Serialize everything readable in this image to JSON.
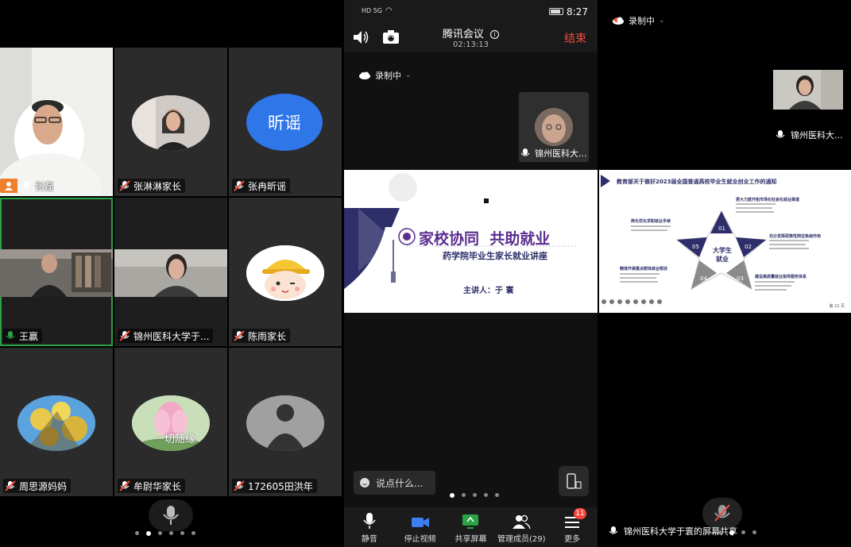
{
  "left": {
    "participants": [
      {
        "name": "张磊",
        "kind": "photo-man",
        "host": true
      },
      {
        "name": "张淋淋家长",
        "kind": "photo-woman"
      },
      {
        "name": "张冉昕谣",
        "kind": "text-avatar",
        "avatar_text": "昕谣"
      },
      {
        "name": "王赢",
        "kind": "video-room",
        "active": true
      },
      {
        "name": "锦州医科大学于...",
        "kind": "video-woman"
      },
      {
        "name": "陈雨家长",
        "kind": "cartoon"
      },
      {
        "name": "周思源妈妈",
        "kind": "flowers-yellow"
      },
      {
        "name": "牟尉华家长",
        "kind": "lotus",
        "overlay_text": "一切随缘"
      },
      {
        "name": "172605田洪年",
        "kind": "silhouette"
      }
    ]
  },
  "mid": {
    "status": {
      "time": "8:27",
      "network": "HD 5G"
    },
    "app_title": "腾讯会议",
    "duration": "02:13:13",
    "end_label": "结束",
    "recording_label": "录制中",
    "self_tile_name": "锦州医科大...",
    "slide": {
      "title": "家校协同  共助就业",
      "subtitle": "药学院毕业生家长就业讲座",
      "speaker": "主讲人：于 寰"
    },
    "chat_placeholder": "说点什么...",
    "toolbar": [
      {
        "label": "静音",
        "icon": "mic-icon"
      },
      {
        "label": "停止视频",
        "icon": "video-icon"
      },
      {
        "label": "共享屏幕",
        "icon": "share-screen-icon"
      },
      {
        "label": "管理成员(29)",
        "icon": "members-icon"
      },
      {
        "label": "更多",
        "icon": "more-icon",
        "badge": "11"
      }
    ]
  },
  "right": {
    "recording_label": "录制中",
    "self_tile_name": "锦州医科大...",
    "slide": {
      "header": "教育部关于做好2023届全国普通高校毕业生就业创业工作的通知",
      "center": "大学生就业",
      "items": [
        {
          "num": "01",
          "title": "更大力度开拓市场化社会化就业渠道"
        },
        {
          "num": "02",
          "title": "充分发挥政策性岗位吸纳作用"
        },
        {
          "num": "03",
          "title": "建设高质量就业指导服务体系"
        },
        {
          "num": "04",
          "title": "精准开展重点群体就业帮扶"
        },
        {
          "num": "05",
          "title": "简化优化求职就业手续"
        }
      ],
      "page": "第 22 页"
    },
    "footer_name": "锦州医科大学于寰的屏幕共享"
  },
  "colors": {
    "accent_green": "#2ba245",
    "end_red": "#f04c3e",
    "slide_navy": "#2e2e6a",
    "slide_purple": "#5b2d8e",
    "badge_red": "#f5483b"
  }
}
